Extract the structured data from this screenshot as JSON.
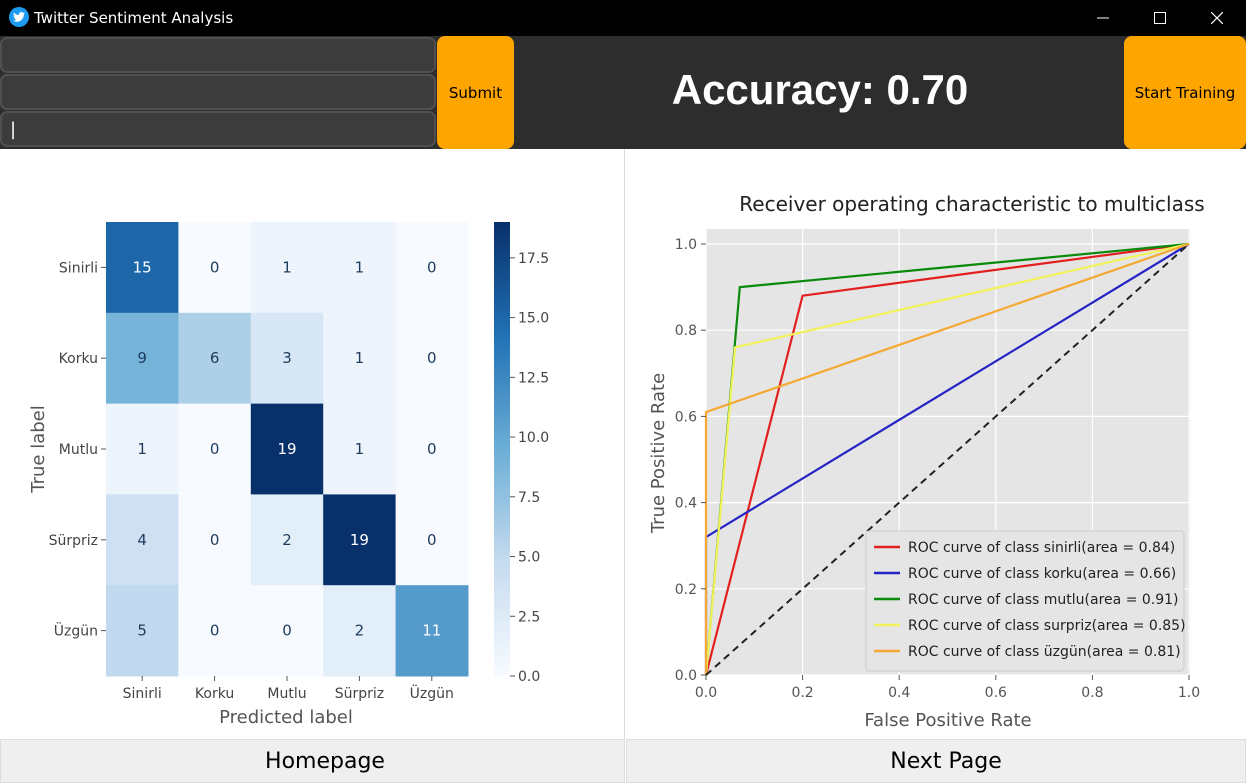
{
  "window": {
    "title": "Twitter Sentiment Analysis"
  },
  "inputs": [
    {
      "value": ""
    },
    {
      "value": ""
    },
    {
      "value": "|"
    }
  ],
  "buttons": {
    "submit": "Submit",
    "start_training": "Start Training"
  },
  "accuracy_text": "Accuracy: 0.70",
  "nav": {
    "homepage": "Homepage",
    "next_page": "Next Page"
  },
  "chart_data": [
    {
      "type": "heatmap",
      "title": "",
      "xlabel": "Predicted label",
      "ylabel": "True label",
      "x_categories": [
        "Sinirli",
        "Korku",
        "Mutlu",
        "Sürpriz",
        "Üzgün"
      ],
      "y_categories": [
        "Sinirli",
        "Korku",
        "Mutlu",
        "Sürpriz",
        "Üzgün"
      ],
      "values": [
        [
          15,
          0,
          1,
          1,
          0
        ],
        [
          9,
          6,
          3,
          1,
          0
        ],
        [
          1,
          0,
          19,
          1,
          0
        ],
        [
          4,
          0,
          2,
          19,
          0
        ],
        [
          5,
          0,
          0,
          2,
          11
        ]
      ],
      "colorbar": {
        "min": 0,
        "max": 19,
        "ticks": [
          "0.0",
          "2.5",
          "5.0",
          "7.5",
          "10.0",
          "12.5",
          "15.0",
          "17.5"
        ]
      },
      "colormap": "Blues"
    },
    {
      "type": "line",
      "title": "Receiver operating characteristic to multiclass",
      "xlabel": "False Positive Rate",
      "ylabel": "True Positive Rate",
      "xlim": [
        0,
        1
      ],
      "ylim": [
        0,
        1
      ],
      "xticks": [
        "0.0",
        "0.2",
        "0.4",
        "0.6",
        "0.8",
        "1.0"
      ],
      "yticks": [
        "0.0",
        "0.2",
        "0.4",
        "0.6",
        "0.8",
        "1.0"
      ],
      "grid": true,
      "legend_position": "bottom-right",
      "series": [
        {
          "name": "ROC curve of class sinirli(area = 0.84)",
          "color": "#e32020",
          "x": [
            0,
            0.2,
            1
          ],
          "y": [
            0,
            0.88,
            1
          ]
        },
        {
          "name": "ROC curve of class korku(area = 0.66)",
          "color": "#2424c4",
          "x": [
            0,
            0,
            1
          ],
          "y": [
            0,
            0.32,
            1
          ]
        },
        {
          "name": "ROC curve of class mutlu(area = 0.91)",
          "color": "#0a8a0a",
          "x": [
            0,
            0.07,
            1
          ],
          "y": [
            0,
            0.9,
            1
          ]
        },
        {
          "name": "ROC curve of class surpriz(area = 0.85)",
          "color": "#f2f25a",
          "x": [
            0,
            0.06,
            1
          ],
          "y": [
            0,
            0.76,
            1
          ]
        },
        {
          "name": "ROC curve of class üzgün(area = 0.81)",
          "color": "#f5a832",
          "x": [
            0,
            0,
            1
          ],
          "y": [
            0,
            0.61,
            1
          ]
        }
      ],
      "diagonal": {
        "color": "#222222",
        "style": "dashed"
      }
    }
  ]
}
